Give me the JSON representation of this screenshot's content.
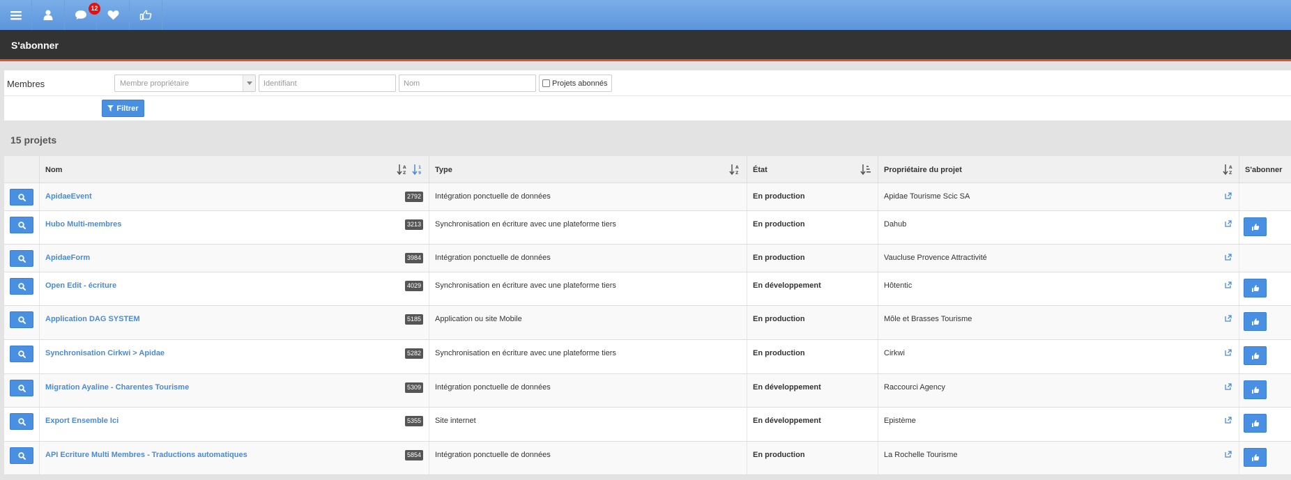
{
  "nav": {
    "notifications_count": "12"
  },
  "page": {
    "title": "S'abonner"
  },
  "filters": {
    "label": "Membres",
    "owner_placeholder": "Membre propriétaire",
    "identifiant_placeholder": "Identifiant",
    "nom_placeholder": "Nom",
    "subscribed_label": "Projets abonnés",
    "filter_button": "Filtrer"
  },
  "results": {
    "count_text": "15 projets"
  },
  "table": {
    "headers": {
      "nom": "Nom",
      "type": "Type",
      "etat": "État",
      "proprietaire": "Propriétaire du projet",
      "sabonner": "S'abonner"
    },
    "rows": [
      {
        "nom": "ApidaeEvent",
        "id": "2792",
        "type": "Intégration ponctuelle de données",
        "etat": "En production",
        "proprietaire": "Apidae Tourisme Scic SA",
        "subscribe": false
      },
      {
        "nom": "Hubo Multi-membres",
        "id": "3213",
        "type": "Synchronisation en écriture avec une plateforme tiers",
        "etat": "En production",
        "proprietaire": "Dahub",
        "subscribe": true
      },
      {
        "nom": "ApidaeForm",
        "id": "3984",
        "type": "Intégration ponctuelle de données",
        "etat": "En production",
        "proprietaire": "Vaucluse Provence Attractivité",
        "subscribe": false
      },
      {
        "nom": "Open Edit - écriture",
        "id": "4029",
        "type": "Synchronisation en écriture avec une plateforme tiers",
        "etat": "En développement",
        "proprietaire": "Hôtentic",
        "subscribe": true
      },
      {
        "nom": "Application DAG SYSTEM",
        "id": "5185",
        "type": "Application ou site Mobile",
        "etat": "En production",
        "proprietaire": "Môle et Brasses Tourisme",
        "subscribe": true
      },
      {
        "nom": "Synchronisation Cirkwi > Apidae",
        "id": "5282",
        "type": "Synchronisation en écriture avec une plateforme tiers",
        "etat": "En production",
        "proprietaire": "Cirkwi",
        "subscribe": true
      },
      {
        "nom": "Migration Ayaline - Charentes Tourisme",
        "id": "5309",
        "type": "Intégration ponctuelle de données",
        "etat": "En développement",
        "proprietaire": "Raccourci Agency",
        "subscribe": true
      },
      {
        "nom": "Export Ensemble Ici",
        "id": "5355",
        "type": "Site internet",
        "etat": "En développement",
        "proprietaire": "Epistème",
        "subscribe": true
      },
      {
        "nom": "API Ecriture Multi Membres - Traductions automatiques",
        "id": "5854",
        "type": "Intégration ponctuelle de données",
        "etat": "En production",
        "proprietaire": "La Rochelle Tourisme",
        "subscribe": true
      }
    ]
  },
  "colors": {
    "nav_bg": "#6aa2e2",
    "title_bg": "#333333",
    "accent_line": "#e1522f",
    "button_blue": "#4a90e2",
    "link_blue": "#4a8ad6"
  }
}
